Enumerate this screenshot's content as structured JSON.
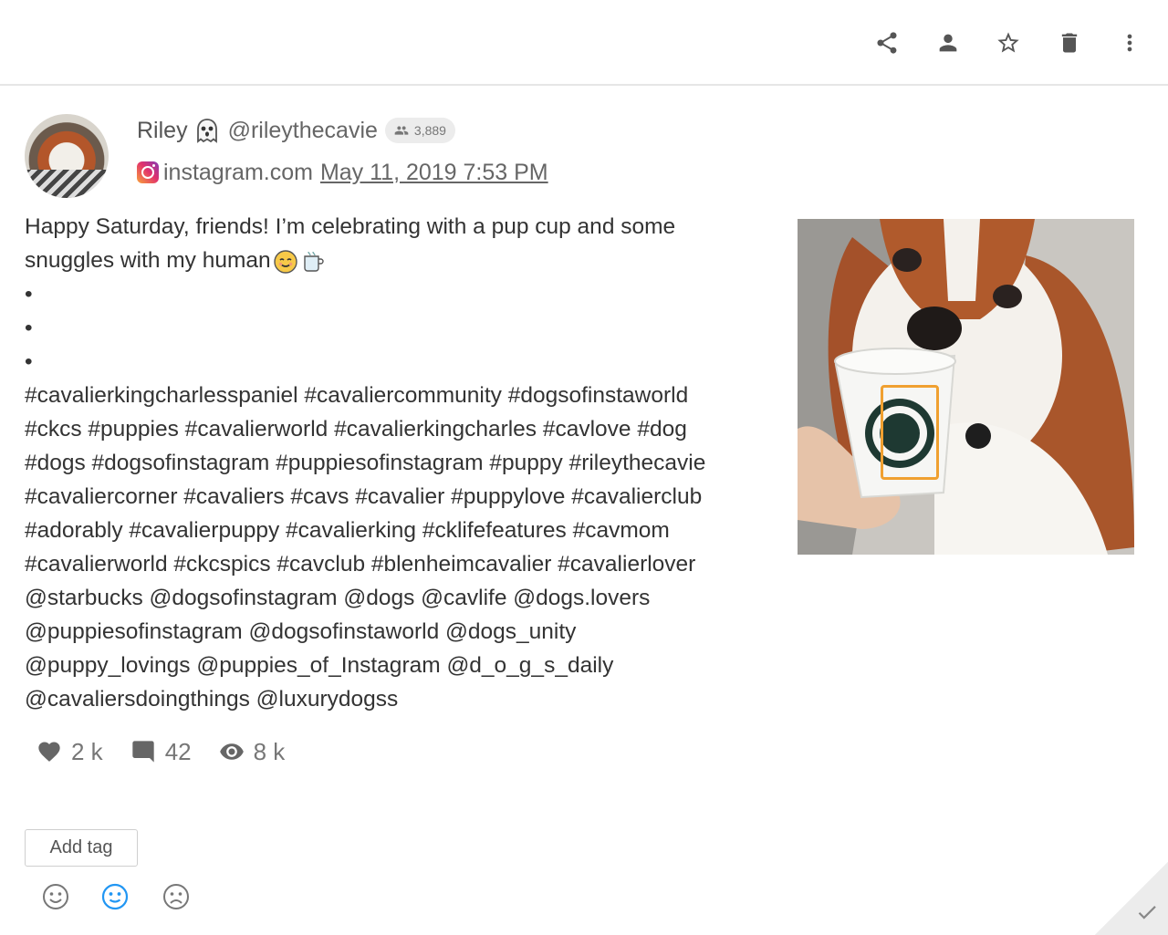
{
  "toolbar": {
    "buttons": [
      {
        "name": "share-icon"
      },
      {
        "name": "person-icon"
      },
      {
        "name": "star-icon"
      },
      {
        "name": "trash-icon"
      },
      {
        "name": "more-vert-icon"
      }
    ]
  },
  "post": {
    "author_name": "Riley",
    "author_emoji": "ghost-icon",
    "handle": "@rileythecavie",
    "followers": "3,889",
    "source": "instagram.com",
    "date": "May 11, 2019 7:53 PM",
    "body_lines": [
      "Happy Saturday, friends! I’m celebrating with a pup cup and some",
      "snuggles with my human",
      "•",
      "•",
      "•",
      "#cavalierkingcharlesspaniel #cavaliercommunity #dogsofinstaworld",
      "#ckcs #puppies #cavalierworld #cavalierkingcharles #cavlove #dog",
      "#dogs #dogsofinstagram #puppiesofinstagram #puppy #rileythecavie",
      "#cavaliercorner #cavaliers #cavs #cavalier #puppylove #cavalierclub",
      "#adorably #cavalierpuppy #cavalierking #cklifefeatures #cavmom",
      "#cavalierworld #ckcspics #cavclub #blenheimcavalier #cavalierlover",
      "@starbucks @dogsofinstagram @dogs @cavlife @dogs.lovers",
      "@puppiesofinstagram @dogsofinstaworld @dogs_unity",
      "@puppy_lovings @puppies_of_Instagram @d_o_g_s_daily",
      "@cavaliersdoingthings @luxurydogss"
    ],
    "inline_emojis": [
      "smiling-face-icon",
      "hot-beverage-icon"
    ]
  },
  "stats": {
    "likes": "2 k",
    "comments": "42",
    "views": "8 k"
  },
  "tags": {
    "add_label": "Add tag"
  },
  "sentiment": {
    "options": [
      "positive",
      "neutral",
      "negative"
    ],
    "selected": "neutral",
    "selected_color": "#2196f3"
  },
  "colors": {
    "detection_box": "#f0a030"
  }
}
